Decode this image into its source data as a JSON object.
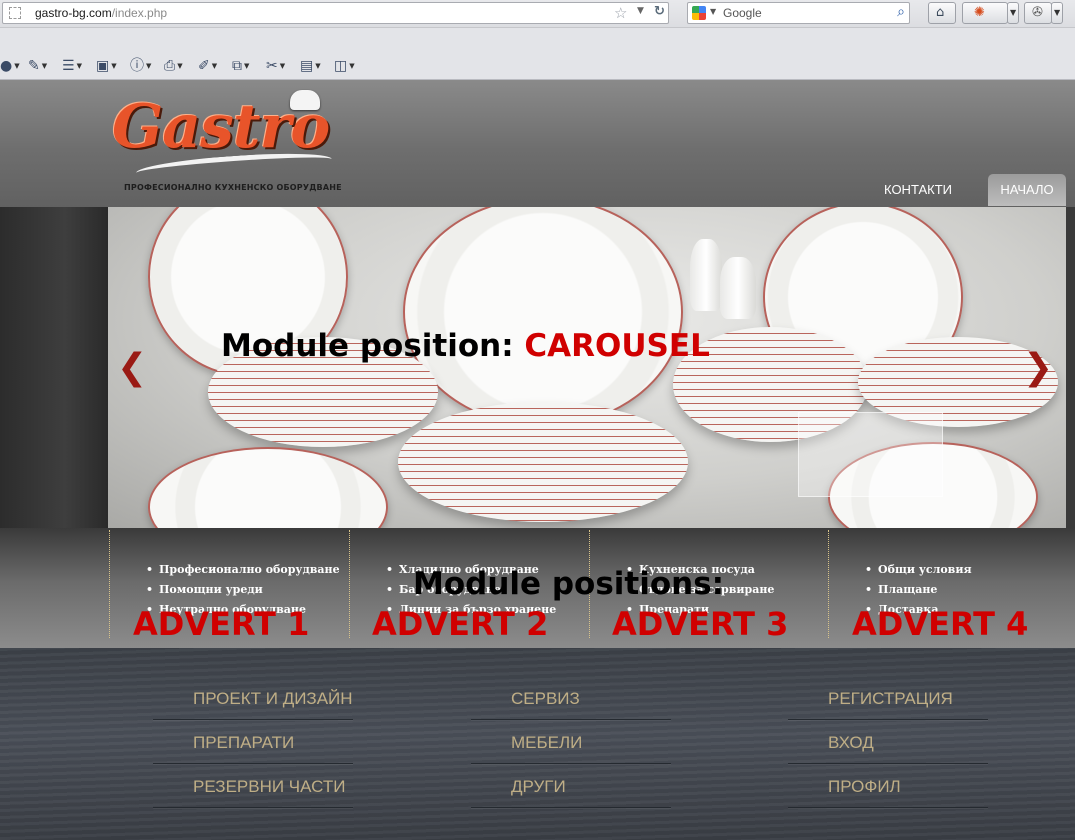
{
  "browser": {
    "url_host": "gastro-bg.com",
    "url_path": "/index.php",
    "search_placeholder": "Google"
  },
  "icons": {
    "favicon": "page-icon",
    "bookmark": "star-icon",
    "reload": "reload-icon",
    "search_engine": "google-icon",
    "search_go": "magnifier-icon",
    "home": "home-icon",
    "addon": "firebug-icon",
    "extension": "puzzle-icon",
    "carousel_prev": "chevron-left-icon",
    "carousel_next": "chevron-right-icon"
  },
  "toolbar": {
    "tools": [
      "user-icon",
      "pencil-icon",
      "form-icon",
      "image-icon",
      "info-icon",
      "print-icon",
      "highlighter-icon",
      "resize-icon",
      "tools-icon",
      "source-icon",
      "layout-icon"
    ]
  },
  "site": {
    "logo_text": "Gastro",
    "tagline": "ПРОФЕСИОНАЛНО КУХНЕНСКО ОБОРУДВАНЕ",
    "nav": {
      "contacts": "КОНТАКТИ",
      "home": "НАЧАЛО"
    }
  },
  "carousel": {
    "label_prefix": "Module position:",
    "label_name": "CAROUSEL",
    "prev": "❮",
    "next": "❯"
  },
  "adverts": {
    "heading": "Module positions:",
    "columns": [
      {
        "label": "ADVERT 1",
        "items": [
          "Професионално оборудване",
          "Помощни уреди",
          "Неутрално оборудване"
        ]
      },
      {
        "label": "ADVERT 2",
        "items": [
          "Хладилно оборудване",
          "Бар оборудване",
          "Линии за бързо хранене"
        ]
      },
      {
        "label": "ADVERT 3",
        "items": [
          "Кухненска посуда",
          "Съдове за сервиране",
          "Препарати"
        ]
      },
      {
        "label": "ADVERT 4",
        "items": [
          "Общи условия",
          "Плащане",
          "Доставка"
        ]
      }
    ]
  },
  "footer": {
    "columns": [
      [
        "ПРОЕКТ И ДИЗАЙН",
        "ПРЕПАРАТИ",
        "РЕЗЕРВНИ ЧАСТИ"
      ],
      [
        "СЕРВИЗ",
        "МЕБЕЛИ",
        "ДРУГИ"
      ],
      [
        "РЕГИСТРАЦИЯ",
        "ВХОД",
        "ПРОФИЛ"
      ]
    ]
  }
}
